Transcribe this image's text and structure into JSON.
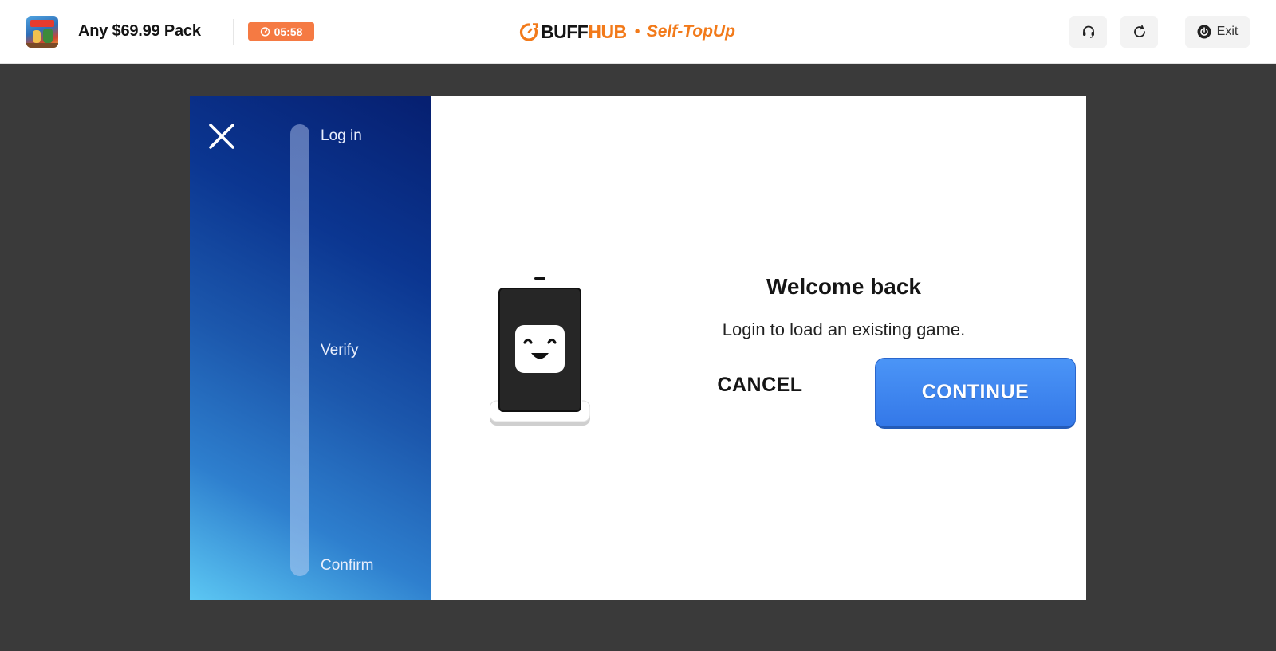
{
  "topbar": {
    "pack_title": "Any $69.99 Pack",
    "timer": "05:58",
    "brand_part1": "BUFF",
    "brand_part2": "HUB",
    "brand_separator": "•",
    "brand_subtitle": "Self-TopUp",
    "exit_label": "Exit",
    "icons": {
      "game_thumbnail": "game-thumbnail",
      "timer": "stopwatch-icon",
      "brand_logo": "buffhub-logo",
      "support": "headset-icon",
      "refresh": "refresh-icon",
      "exit": "power-icon"
    }
  },
  "modal": {
    "steps": [
      "Log in",
      "Verify",
      "Confirm"
    ],
    "title": "Welcome back",
    "subtitle": "Login to load an existing game.",
    "cancel_label": "CANCEL",
    "continue_label": "CONTINUE",
    "icons": {
      "close": "close-icon",
      "illustration": "phone-smiley-illustration"
    }
  },
  "colors": {
    "accent_orange": "#f27a1a",
    "timer_badge": "#f57a43",
    "continue_blue": "#3d86f0",
    "panel_blue_dark": "#061f70",
    "panel_blue_light": "#5cc7f3",
    "backdrop": "#3a3a3a"
  }
}
